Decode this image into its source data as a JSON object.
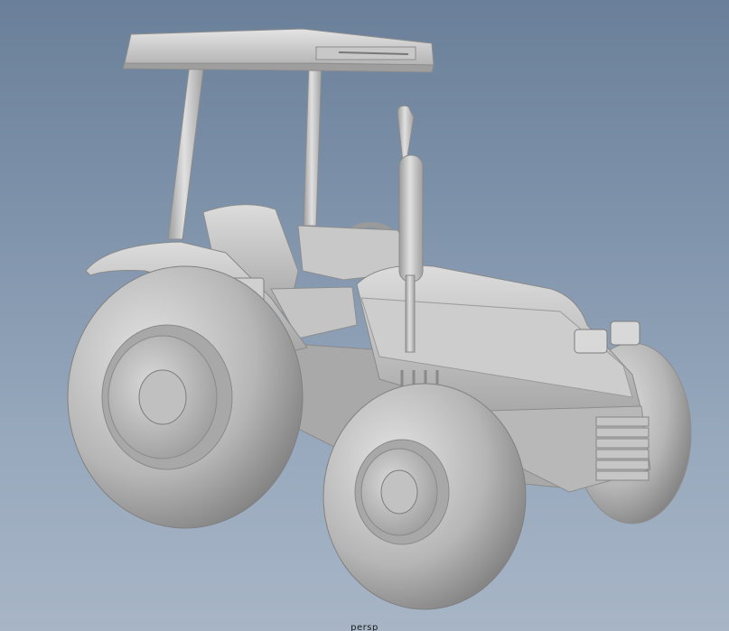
{
  "viewport": {
    "camera_label": "persp",
    "background_top": "#6a7f99",
    "background_bottom": "#a7b5c6"
  },
  "model": {
    "subject": "tractor-icon",
    "shade_base": "#b9b9b9",
    "shade_light": "#dcdcdc",
    "shade_dark": "#8a8a8a"
  }
}
